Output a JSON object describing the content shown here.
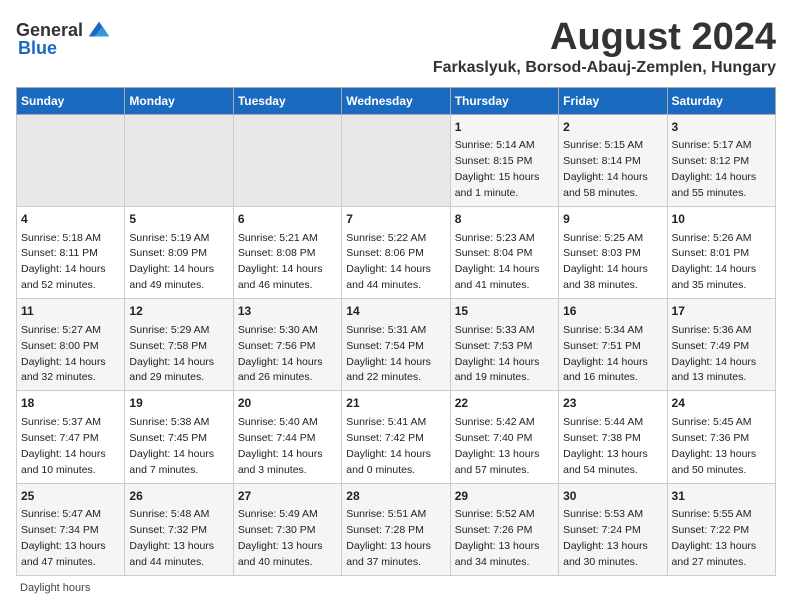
{
  "logo": {
    "general": "General",
    "blue": "Blue"
  },
  "title": "August 2024",
  "subtitle": "Farkaslyuk, Borsod-Abauj-Zemplen, Hungary",
  "days_of_week": [
    "Sunday",
    "Monday",
    "Tuesday",
    "Wednesday",
    "Thursday",
    "Friday",
    "Saturday"
  ],
  "footer": "Daylight hours",
  "weeks": [
    [
      {
        "day": "",
        "info": ""
      },
      {
        "day": "",
        "info": ""
      },
      {
        "day": "",
        "info": ""
      },
      {
        "day": "",
        "info": ""
      },
      {
        "day": "1",
        "info": "Sunrise: 5:14 AM\nSunset: 8:15 PM\nDaylight: 15 hours\nand 1 minute."
      },
      {
        "day": "2",
        "info": "Sunrise: 5:15 AM\nSunset: 8:14 PM\nDaylight: 14 hours\nand 58 minutes."
      },
      {
        "day": "3",
        "info": "Sunrise: 5:17 AM\nSunset: 8:12 PM\nDaylight: 14 hours\nand 55 minutes."
      }
    ],
    [
      {
        "day": "4",
        "info": "Sunrise: 5:18 AM\nSunset: 8:11 PM\nDaylight: 14 hours\nand 52 minutes."
      },
      {
        "day": "5",
        "info": "Sunrise: 5:19 AM\nSunset: 8:09 PM\nDaylight: 14 hours\nand 49 minutes."
      },
      {
        "day": "6",
        "info": "Sunrise: 5:21 AM\nSunset: 8:08 PM\nDaylight: 14 hours\nand 46 minutes."
      },
      {
        "day": "7",
        "info": "Sunrise: 5:22 AM\nSunset: 8:06 PM\nDaylight: 14 hours\nand 44 minutes."
      },
      {
        "day": "8",
        "info": "Sunrise: 5:23 AM\nSunset: 8:04 PM\nDaylight: 14 hours\nand 41 minutes."
      },
      {
        "day": "9",
        "info": "Sunrise: 5:25 AM\nSunset: 8:03 PM\nDaylight: 14 hours\nand 38 minutes."
      },
      {
        "day": "10",
        "info": "Sunrise: 5:26 AM\nSunset: 8:01 PM\nDaylight: 14 hours\nand 35 minutes."
      }
    ],
    [
      {
        "day": "11",
        "info": "Sunrise: 5:27 AM\nSunset: 8:00 PM\nDaylight: 14 hours\nand 32 minutes."
      },
      {
        "day": "12",
        "info": "Sunrise: 5:29 AM\nSunset: 7:58 PM\nDaylight: 14 hours\nand 29 minutes."
      },
      {
        "day": "13",
        "info": "Sunrise: 5:30 AM\nSunset: 7:56 PM\nDaylight: 14 hours\nand 26 minutes."
      },
      {
        "day": "14",
        "info": "Sunrise: 5:31 AM\nSunset: 7:54 PM\nDaylight: 14 hours\nand 22 minutes."
      },
      {
        "day": "15",
        "info": "Sunrise: 5:33 AM\nSunset: 7:53 PM\nDaylight: 14 hours\nand 19 minutes."
      },
      {
        "day": "16",
        "info": "Sunrise: 5:34 AM\nSunset: 7:51 PM\nDaylight: 14 hours\nand 16 minutes."
      },
      {
        "day": "17",
        "info": "Sunrise: 5:36 AM\nSunset: 7:49 PM\nDaylight: 14 hours\nand 13 minutes."
      }
    ],
    [
      {
        "day": "18",
        "info": "Sunrise: 5:37 AM\nSunset: 7:47 PM\nDaylight: 14 hours\nand 10 minutes."
      },
      {
        "day": "19",
        "info": "Sunrise: 5:38 AM\nSunset: 7:45 PM\nDaylight: 14 hours\nand 7 minutes."
      },
      {
        "day": "20",
        "info": "Sunrise: 5:40 AM\nSunset: 7:44 PM\nDaylight: 14 hours\nand 3 minutes."
      },
      {
        "day": "21",
        "info": "Sunrise: 5:41 AM\nSunset: 7:42 PM\nDaylight: 14 hours\nand 0 minutes."
      },
      {
        "day": "22",
        "info": "Sunrise: 5:42 AM\nSunset: 7:40 PM\nDaylight: 13 hours\nand 57 minutes."
      },
      {
        "day": "23",
        "info": "Sunrise: 5:44 AM\nSunset: 7:38 PM\nDaylight: 13 hours\nand 54 minutes."
      },
      {
        "day": "24",
        "info": "Sunrise: 5:45 AM\nSunset: 7:36 PM\nDaylight: 13 hours\nand 50 minutes."
      }
    ],
    [
      {
        "day": "25",
        "info": "Sunrise: 5:47 AM\nSunset: 7:34 PM\nDaylight: 13 hours\nand 47 minutes."
      },
      {
        "day": "26",
        "info": "Sunrise: 5:48 AM\nSunset: 7:32 PM\nDaylight: 13 hours\nand 44 minutes."
      },
      {
        "day": "27",
        "info": "Sunrise: 5:49 AM\nSunset: 7:30 PM\nDaylight: 13 hours\nand 40 minutes."
      },
      {
        "day": "28",
        "info": "Sunrise: 5:51 AM\nSunset: 7:28 PM\nDaylight: 13 hours\nand 37 minutes."
      },
      {
        "day": "29",
        "info": "Sunrise: 5:52 AM\nSunset: 7:26 PM\nDaylight: 13 hours\nand 34 minutes."
      },
      {
        "day": "30",
        "info": "Sunrise: 5:53 AM\nSunset: 7:24 PM\nDaylight: 13 hours\nand 30 minutes."
      },
      {
        "day": "31",
        "info": "Sunrise: 5:55 AM\nSunset: 7:22 PM\nDaylight: 13 hours\nand 27 minutes."
      }
    ]
  ]
}
